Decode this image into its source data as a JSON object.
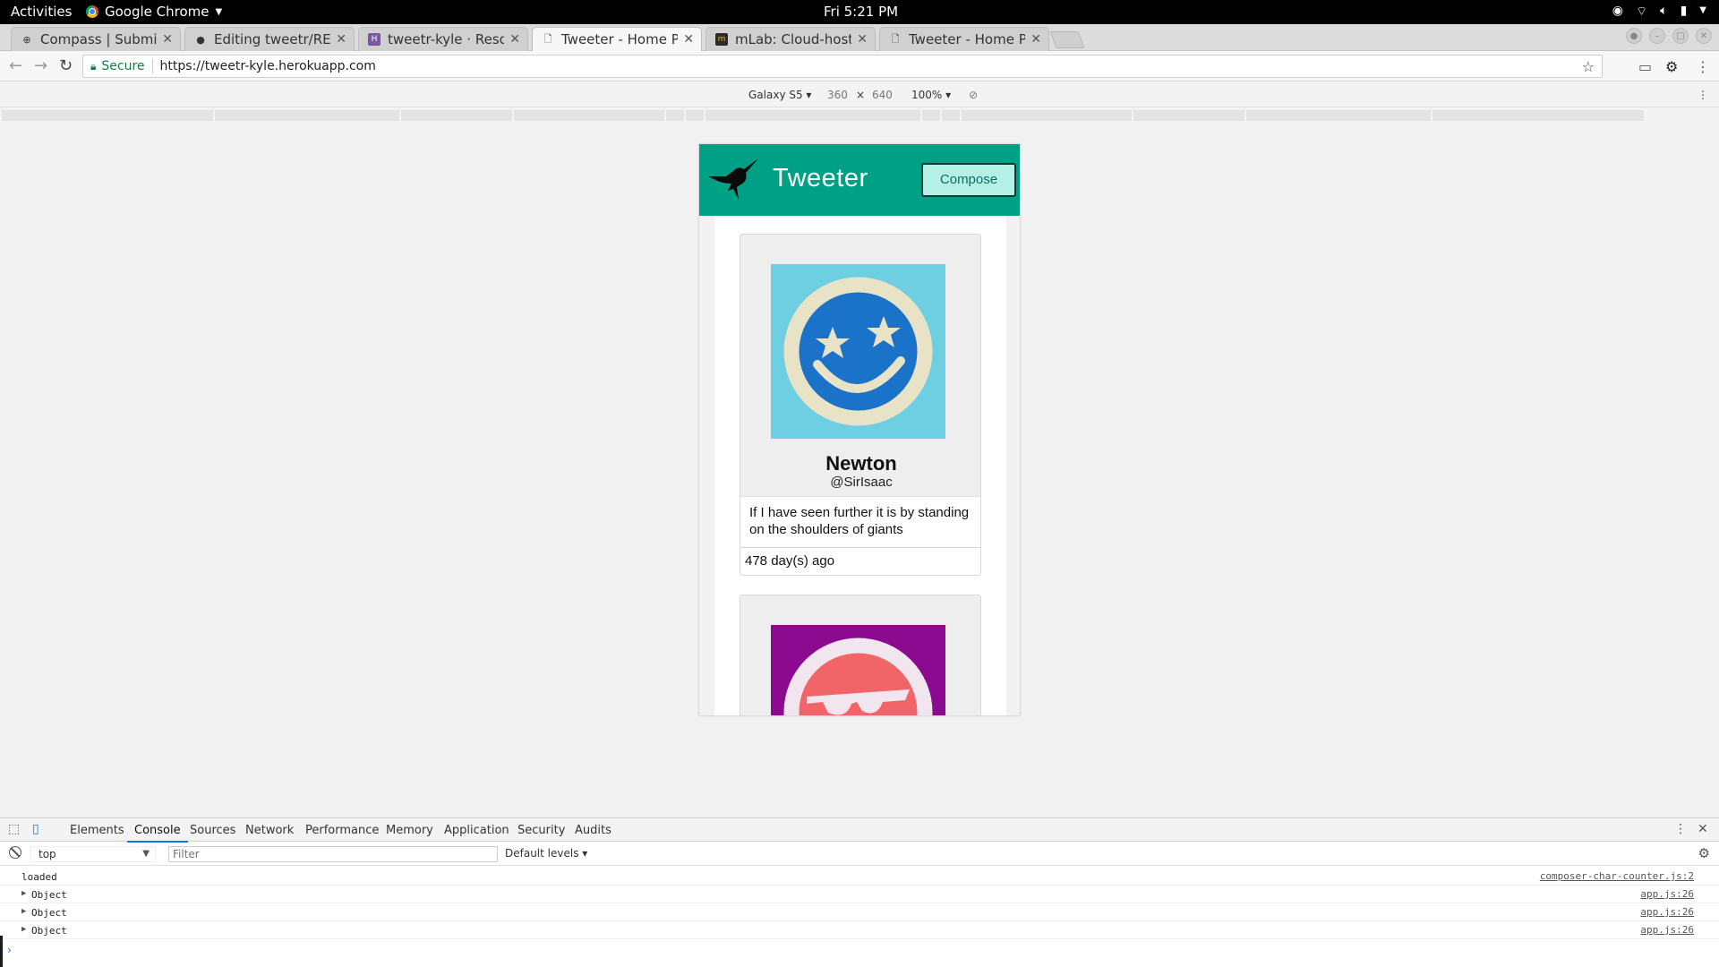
{
  "topbar": {
    "activities": "Activities",
    "app_name": "Google Chrome",
    "clock": "Fri  5:21 PM"
  },
  "tabs": [
    {
      "title": "Compass | Submit F",
      "icon": "compass-icon",
      "active": false
    },
    {
      "title": "Editing tweetr/REA",
      "icon": "github-icon",
      "active": false
    },
    {
      "title": "tweetr-kyle · Resou",
      "icon": "heroku-icon",
      "active": false
    },
    {
      "title": "Tweeter - Home Pa",
      "icon": "page-icon",
      "active": true
    },
    {
      "title": "mLab: Cloud-hoste",
      "icon": "mlab-icon",
      "active": false
    },
    {
      "title": "Tweeter - Home Pa",
      "icon": "page-icon",
      "active": false
    }
  ],
  "address": {
    "secure_label": "Secure",
    "url": "https://tweetr-kyle.herokuapp.com"
  },
  "device_toolbar": {
    "device": "Galaxy S5",
    "width": "360",
    "times": "×",
    "height": "640",
    "zoom": "100%"
  },
  "app": {
    "title": "Tweeter",
    "compose_label": "Compose",
    "tweets": [
      {
        "name": "Newton",
        "handle": "@SirIsaac",
        "text": "If I have seen further it is by standing on the shoulders of giants",
        "timestamp": "478 day(s) ago",
        "avatar_bg": "#6fcfe2"
      },
      {
        "name": "",
        "handle": "",
        "text": "",
        "timestamp": "",
        "avatar_bg": "#8b0a8f"
      }
    ]
  },
  "devtools": {
    "tabs": [
      "Elements",
      "Console",
      "Sources",
      "Network",
      "Performance",
      "Memory",
      "Application",
      "Security",
      "Audits"
    ],
    "active_tab": "Console",
    "context": "top",
    "filter_placeholder": "Filter",
    "levels": "Default levels",
    "logs": [
      {
        "message": "loaded",
        "source": "composer-char-counter.js:2",
        "expandable": false
      },
      {
        "message": "Object",
        "source": "app.js:26",
        "expandable": true
      },
      {
        "message": "Object",
        "source": "app.js:26",
        "expandable": true
      },
      {
        "message": "Object",
        "source": "app.js:26",
        "expandable": true
      }
    ],
    "prompt": "›"
  },
  "colors": {
    "brand_teal": "#00a087",
    "compose_bg": "#b5f0e6",
    "devtools_accent": "#1a73e8"
  }
}
